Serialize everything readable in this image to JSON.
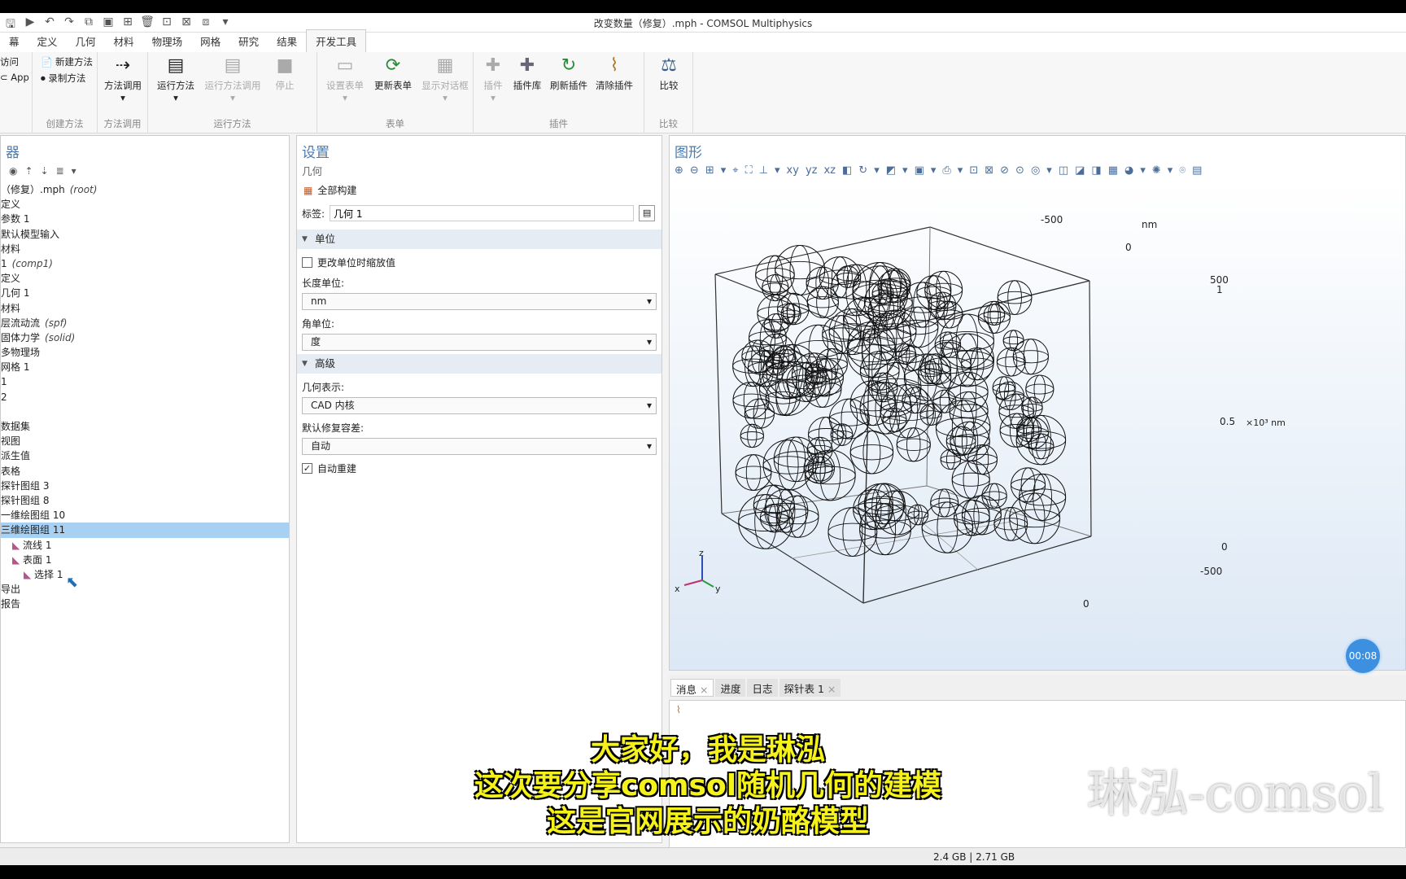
{
  "window": {
    "title": "改变数量（修复）.mph - COMSOL Multiphysics"
  },
  "ribbon_tabs": [
    "幕",
    "定义",
    "几何",
    "材料",
    "物理场",
    "网格",
    "研究",
    "结果",
    "开发工具"
  ],
  "ribbon": {
    "access_left": [
      "访问",
      "App"
    ],
    "create_method": {
      "new": "新建方法",
      "record": "录制方法",
      "caption": "创建方法"
    },
    "method_call": {
      "label": "方法调用",
      "caption": "方法调用"
    },
    "run_method": {
      "run": "运行方法",
      "run_call": "运行方法调用",
      "stop": "停止",
      "caption": "运行方法"
    },
    "forms": {
      "set": "设置表单",
      "update": "更新表单",
      "dialog": "显示对话框",
      "caption": "表单"
    },
    "addins": {
      "addin": "插件",
      "library": "插件库",
      "refresh": "刷新插件",
      "clear": "清除插件",
      "caption": "插件"
    },
    "compare": {
      "label": "比较",
      "caption": "比较"
    }
  },
  "model_builder": {
    "title": "器",
    "items": [
      {
        "text": "（修复）.mph",
        "extra": "(root)",
        "indent": 0
      },
      {
        "text": "定义",
        "extra": "",
        "indent": 0
      },
      {
        "text": "参数 1",
        "extra": "",
        "indent": 0
      },
      {
        "text": "默认模型输入",
        "extra": "",
        "indent": 0
      },
      {
        "text": "材料",
        "extra": "",
        "indent": 0
      },
      {
        "text": "1",
        "extra": "(comp1)",
        "indent": 0
      },
      {
        "text": "定义",
        "extra": "",
        "indent": 0
      },
      {
        "text": "几何 1",
        "extra": "",
        "indent": 0
      },
      {
        "text": "材料",
        "extra": "",
        "indent": 0
      },
      {
        "text": "层流动流",
        "extra": "(spf)",
        "indent": 0
      },
      {
        "text": "固体力学",
        "extra": "(solid)",
        "indent": 0
      },
      {
        "text": "多物理场",
        "extra": "",
        "indent": 0
      },
      {
        "text": "网格 1",
        "extra": "",
        "indent": 0
      },
      {
        "text": "1",
        "extra": "",
        "indent": 0
      },
      {
        "text": "2",
        "extra": "",
        "indent": 0
      },
      {
        "text": "",
        "extra": "",
        "indent": 0
      },
      {
        "text": "数据集",
        "extra": "",
        "indent": 0
      },
      {
        "text": "视图",
        "extra": "",
        "indent": 0
      },
      {
        "text": "派生值",
        "extra": "",
        "indent": 0
      },
      {
        "text": "表格",
        "extra": "",
        "indent": 0
      },
      {
        "text": "探针图组 3",
        "extra": "",
        "indent": 0
      },
      {
        "text": "探针图组 8",
        "extra": "",
        "indent": 0
      },
      {
        "text": "一维绘图组 10",
        "extra": "",
        "indent": 0
      },
      {
        "text": "三维绘图组 11",
        "extra": "",
        "indent": 0
      },
      {
        "text": "流线 1",
        "extra": "",
        "indent": 1
      },
      {
        "text": "表面 1",
        "extra": "",
        "indent": 1
      },
      {
        "text": "选择 1",
        "extra": "",
        "indent": 2
      },
      {
        "text": "导出",
        "extra": "",
        "indent": 0
      },
      {
        "text": "报告",
        "extra": "",
        "indent": 0
      }
    ]
  },
  "settings": {
    "title": "设置",
    "subtitle": "几何",
    "build_all": "全部构建",
    "label_caption": "标签:",
    "label_value": "几何 1",
    "units_section": "单位",
    "scale_values": "更改单位时缩放值",
    "length_unit_label": "长度单位:",
    "length_unit": "nm",
    "angle_unit_label": "角单位:",
    "angle_unit": "度",
    "advanced_section": "高级",
    "geom_rep_label": "几何表示:",
    "geom_rep": "CAD 内核",
    "repair_tol_label": "默认修复容差:",
    "repair_tol": "自动",
    "auto_rebuild": "自动重建"
  },
  "graphics": {
    "title": "图形",
    "axis_labels": {
      "top_neg500": "-500",
      "top_nm": "nm",
      "top_zero": "0",
      "right_500": "500",
      "right_1": "1",
      "right_05": "0.5",
      "right_unit": "×10³ nm",
      "right_zero": "0",
      "bottom_neg500": "-500",
      "bottom_zero": "0"
    },
    "triad": {
      "x": "x",
      "y": "y",
      "z": "z"
    },
    "timer": "00:08"
  },
  "bottom_tabs": [
    "消息",
    "进度",
    "日志",
    "探针表 1"
  ],
  "status_bar": {
    "memory": "2.4 GB | 2.71 GB"
  },
  "subtitles": [
    "大家好，我是琳泓",
    "这次要分享comsol随机几何的建模",
    "这是官网展示的奶酪模型"
  ],
  "watermark": "琳泓-comsol"
}
